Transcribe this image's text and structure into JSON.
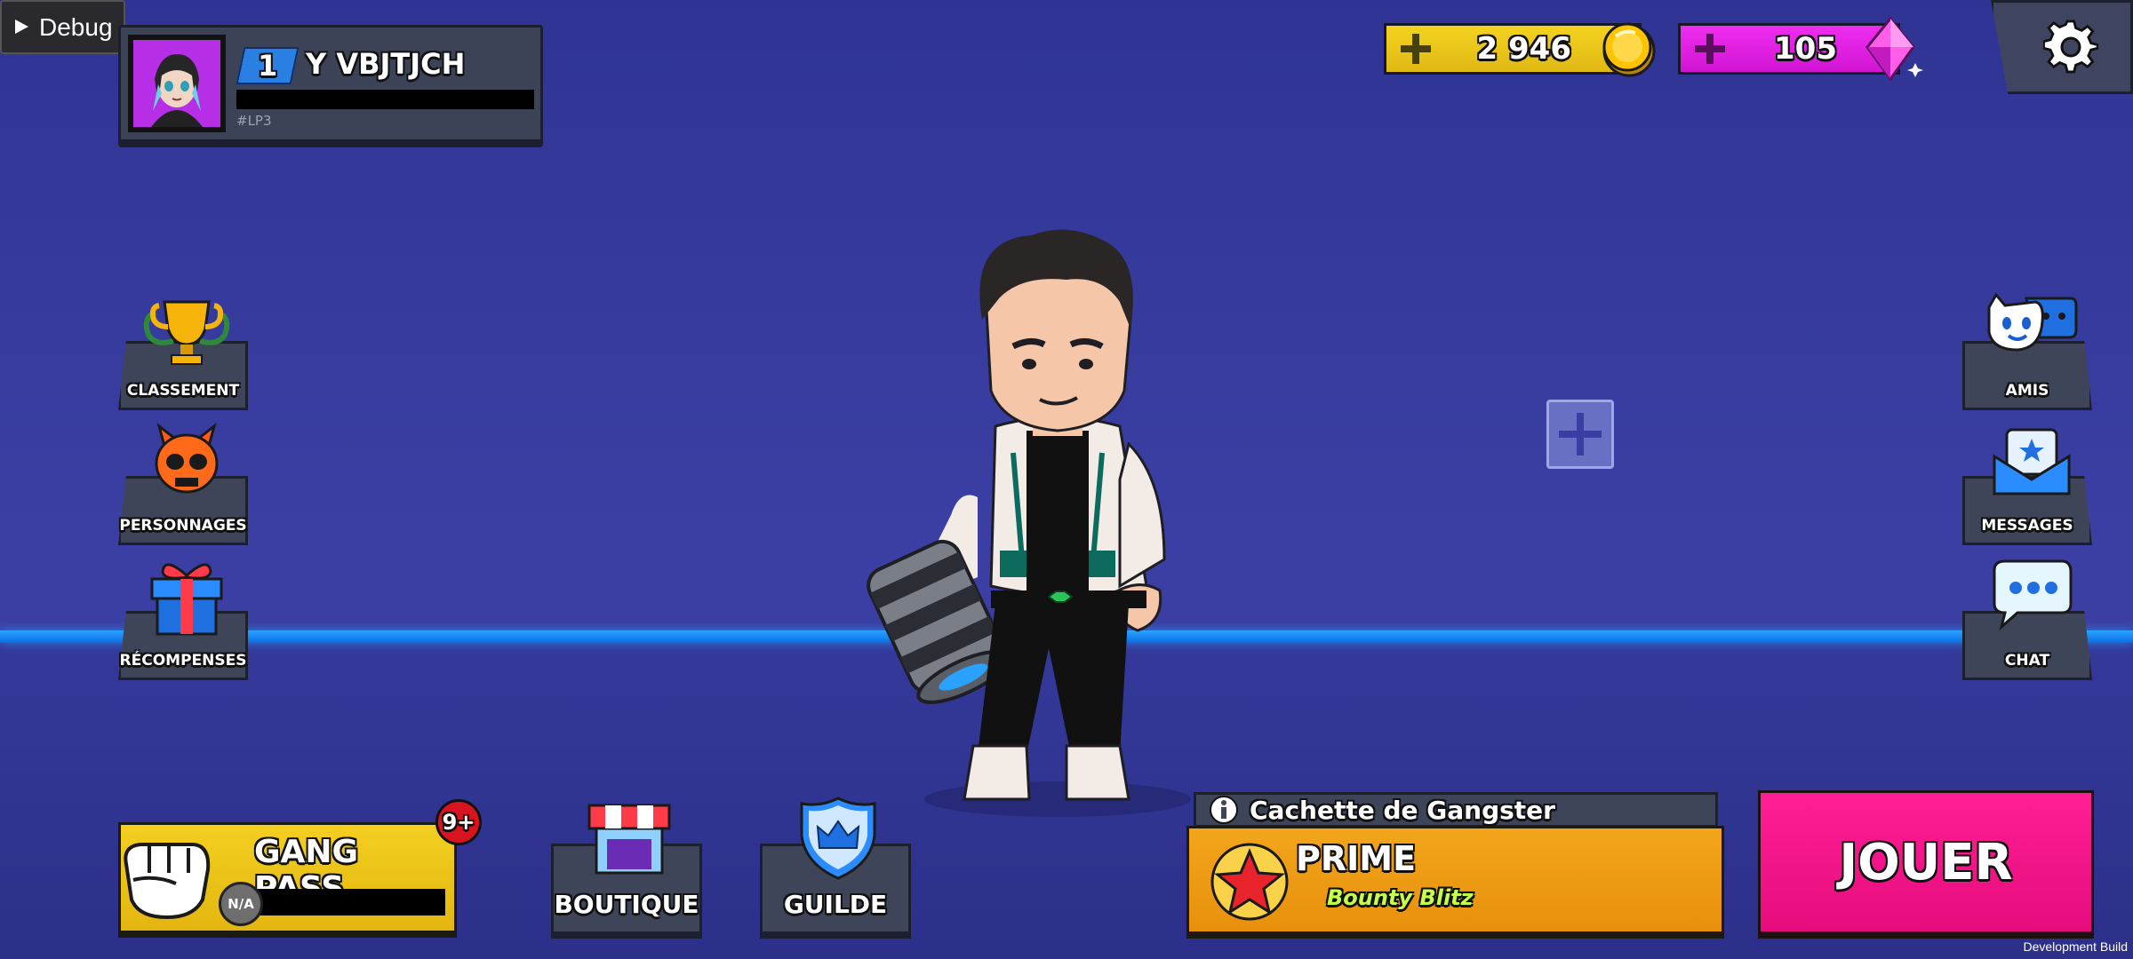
{
  "debug": {
    "label": "Debug"
  },
  "profile": {
    "level": "1",
    "name": "Y VBJTJCH",
    "tag": "#LP3"
  },
  "currency": {
    "coins": "2 946",
    "gems": "105"
  },
  "left_menu": [
    {
      "label": "CLASSEMENT",
      "icon": "trophy-icon"
    },
    {
      "label": "PERSONNAGES",
      "icon": "skull-icon"
    },
    {
      "label": "RÉCOMPENSES",
      "icon": "gift-icon"
    }
  ],
  "right_menu": [
    {
      "label": "AMIS",
      "icon": "friends-icon"
    },
    {
      "label": "MESSAGES",
      "icon": "mail-icon"
    },
    {
      "label": "CHAT",
      "icon": "chat-bubble-icon"
    }
  ],
  "gang_pass": {
    "label": "GANG PASS",
    "badge": "9+",
    "tier": "N/A"
  },
  "bottom_buttons": {
    "shop": "BOUTIQUE",
    "guild": "GUILDE"
  },
  "mode": {
    "map": "Cachette de Gangster",
    "name": "PRIME",
    "subtitle": "Bounty Blitz"
  },
  "play": {
    "label": "JOUER"
  },
  "footer": {
    "build": "Development Build"
  },
  "colors": {
    "coins": "#e8c21a",
    "gems": "#e31fe6",
    "play": "#f21488",
    "mode": "#ef9b12",
    "horizon": "#1e8cff"
  }
}
